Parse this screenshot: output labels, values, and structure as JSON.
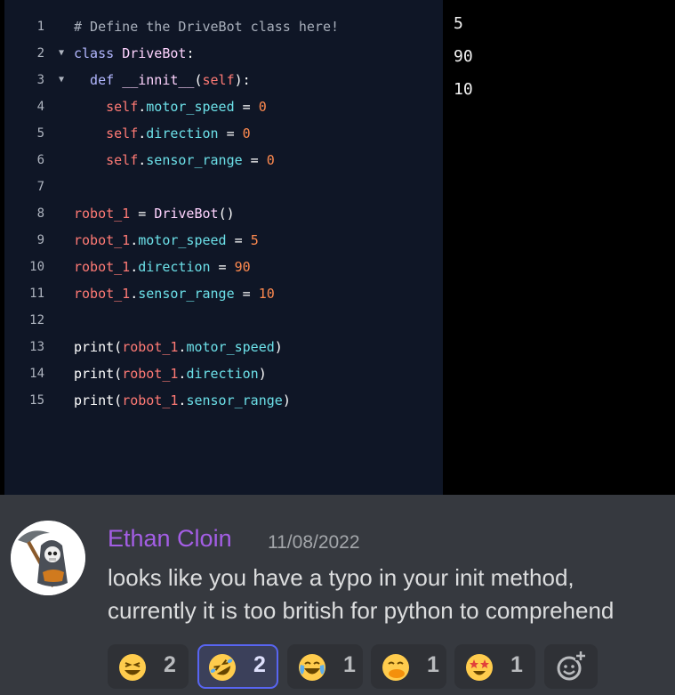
{
  "editor": {
    "lines": [
      {
        "n": "1",
        "fold": false,
        "tokens": [
          [
            "# Define the DriveBot class here!",
            "comment"
          ]
        ]
      },
      {
        "n": "2",
        "fold": true,
        "tokens": [
          [
            "class ",
            "kw"
          ],
          [
            "DriveBot",
            "cls"
          ],
          [
            ":",
            "op"
          ]
        ]
      },
      {
        "n": "3",
        "fold": true,
        "tokens": [
          [
            "  def ",
            "kw"
          ],
          [
            "__innit__",
            "def"
          ],
          [
            "(",
            "op"
          ],
          [
            "self",
            "var"
          ],
          [
            "):",
            "op"
          ]
        ]
      },
      {
        "n": "4",
        "fold": false,
        "tokens": [
          [
            "    self",
            "var"
          ],
          [
            ".",
            "op"
          ],
          [
            "motor_speed",
            "attr"
          ],
          [
            " = ",
            "op"
          ],
          [
            "0",
            "num"
          ]
        ]
      },
      {
        "n": "5",
        "fold": false,
        "tokens": [
          [
            "    self",
            "var"
          ],
          [
            ".",
            "op"
          ],
          [
            "direction",
            "attr"
          ],
          [
            " = ",
            "op"
          ],
          [
            "0",
            "num"
          ]
        ]
      },
      {
        "n": "6",
        "fold": false,
        "tokens": [
          [
            "    self",
            "var"
          ],
          [
            ".",
            "op"
          ],
          [
            "sensor_range",
            "attr"
          ],
          [
            " = ",
            "op"
          ],
          [
            "0",
            "num"
          ]
        ]
      },
      {
        "n": "7",
        "fold": false,
        "tokens": []
      },
      {
        "n": "8",
        "fold": false,
        "tokens": [
          [
            "robot_1",
            "var"
          ],
          [
            " = ",
            "op"
          ],
          [
            "DriveBot",
            "cls"
          ],
          [
            "()",
            "op"
          ]
        ]
      },
      {
        "n": "9",
        "fold": false,
        "tokens": [
          [
            "robot_1",
            "var"
          ],
          [
            ".",
            "op"
          ],
          [
            "motor_speed",
            "attr"
          ],
          [
            " = ",
            "op"
          ],
          [
            "5",
            "num"
          ]
        ]
      },
      {
        "n": "10",
        "fold": false,
        "tokens": [
          [
            "robot_1",
            "var"
          ],
          [
            ".",
            "op"
          ],
          [
            "direction",
            "attr"
          ],
          [
            " = ",
            "op"
          ],
          [
            "90",
            "num"
          ]
        ]
      },
      {
        "n": "11",
        "fold": false,
        "tokens": [
          [
            "robot_1",
            "var"
          ],
          [
            ".",
            "op"
          ],
          [
            "sensor_range",
            "attr"
          ],
          [
            " = ",
            "op"
          ],
          [
            "10",
            "num"
          ]
        ]
      },
      {
        "n": "12",
        "fold": false,
        "tokens": []
      },
      {
        "n": "13",
        "fold": false,
        "tokens": [
          [
            "print",
            "fn"
          ],
          [
            "(",
            "op"
          ],
          [
            "robot_1",
            "var"
          ],
          [
            ".",
            "op"
          ],
          [
            "motor_speed",
            "attr"
          ],
          [
            ")",
            "op"
          ]
        ]
      },
      {
        "n": "14",
        "fold": false,
        "tokens": [
          [
            "print",
            "fn"
          ],
          [
            "(",
            "op"
          ],
          [
            "robot_1",
            "var"
          ],
          [
            ".",
            "op"
          ],
          [
            "direction",
            "attr"
          ],
          [
            ")",
            "op"
          ]
        ]
      },
      {
        "n": "15",
        "fold": false,
        "tokens": [
          [
            "print",
            "fn"
          ],
          [
            "(",
            "op"
          ],
          [
            "robot_1",
            "var"
          ],
          [
            ".",
            "op"
          ],
          [
            "sensor_range",
            "attr"
          ],
          [
            ")",
            "op"
          ]
        ]
      }
    ]
  },
  "output": {
    "lines": [
      "5",
      "90",
      "10"
    ]
  },
  "message": {
    "author": "Ethan Cloin",
    "timestamp": "11/08/2022",
    "text_lines": [
      "looks like you have a typo in your init method,",
      "currently it is too british for python to comprehend"
    ],
    "author_color": "#a45ee5"
  },
  "reactions": [
    {
      "emoji": "laughing-face-icon",
      "count": "2",
      "active": false
    },
    {
      "emoji": "rolling-on-floor-laughing-icon",
      "count": "2",
      "active": true
    },
    {
      "emoji": "joy-face-icon",
      "count": "1",
      "active": false
    },
    {
      "emoji": "face-with-hand-over-mouth-icon",
      "count": "1",
      "active": false
    },
    {
      "emoji": "star-struck-face-icon",
      "count": "1",
      "active": false
    }
  ],
  "add_reaction_icon": "add-reaction-icon"
}
